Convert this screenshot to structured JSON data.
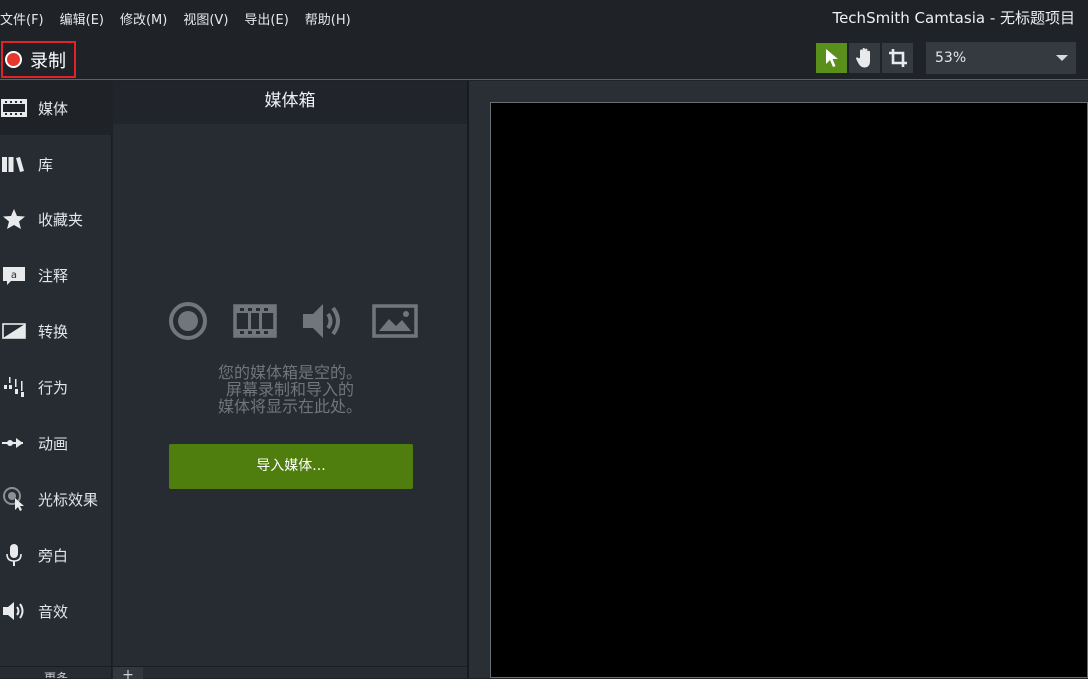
{
  "menu": {
    "items": [
      "文件(F)",
      "编辑(E)",
      "修改(M)",
      "视图(V)",
      "导出(E)",
      "帮助(H)"
    ]
  },
  "window": {
    "title": "TechSmith Camtasia - 无标题项目"
  },
  "toolbar": {
    "record_label": "录制",
    "zoom_value": "53%",
    "tools": [
      "pointer-icon",
      "hand-icon",
      "crop-icon"
    ],
    "accent_color": "#5a8f1c",
    "record_color": "#e8372d"
  },
  "sidebar": {
    "items": [
      {
        "label": "媒体",
        "icon": "film-icon",
        "active": true
      },
      {
        "label": "库",
        "icon": "library-icon",
        "active": false
      },
      {
        "label": "收藏夹",
        "icon": "star-icon",
        "active": false
      },
      {
        "label": "注释",
        "icon": "annotation-icon",
        "active": false
      },
      {
        "label": "转换",
        "icon": "transition-icon",
        "active": false
      },
      {
        "label": "行为",
        "icon": "behavior-icon",
        "active": false
      },
      {
        "label": "动画",
        "icon": "animation-icon",
        "active": false
      },
      {
        "label": "光标效果",
        "icon": "cursor-effect-icon",
        "active": false
      },
      {
        "label": "旁白",
        "icon": "microphone-icon",
        "active": false
      },
      {
        "label": "音效",
        "icon": "speaker-icon",
        "active": false
      }
    ],
    "more_label": "更多"
  },
  "bin": {
    "title": "媒体箱",
    "empty_lines": [
      "您的媒体箱是空的。",
      "屏幕录制和导入的",
      "媒体将显示在此处。"
    ],
    "import_label": "导入媒体...",
    "add_label": "+",
    "placeholder_icons": [
      "record-icon",
      "film-icon",
      "audio-icon",
      "image-icon"
    ],
    "import_color": "#4f7e0e"
  },
  "canvas": {
    "background": "#000000"
  }
}
